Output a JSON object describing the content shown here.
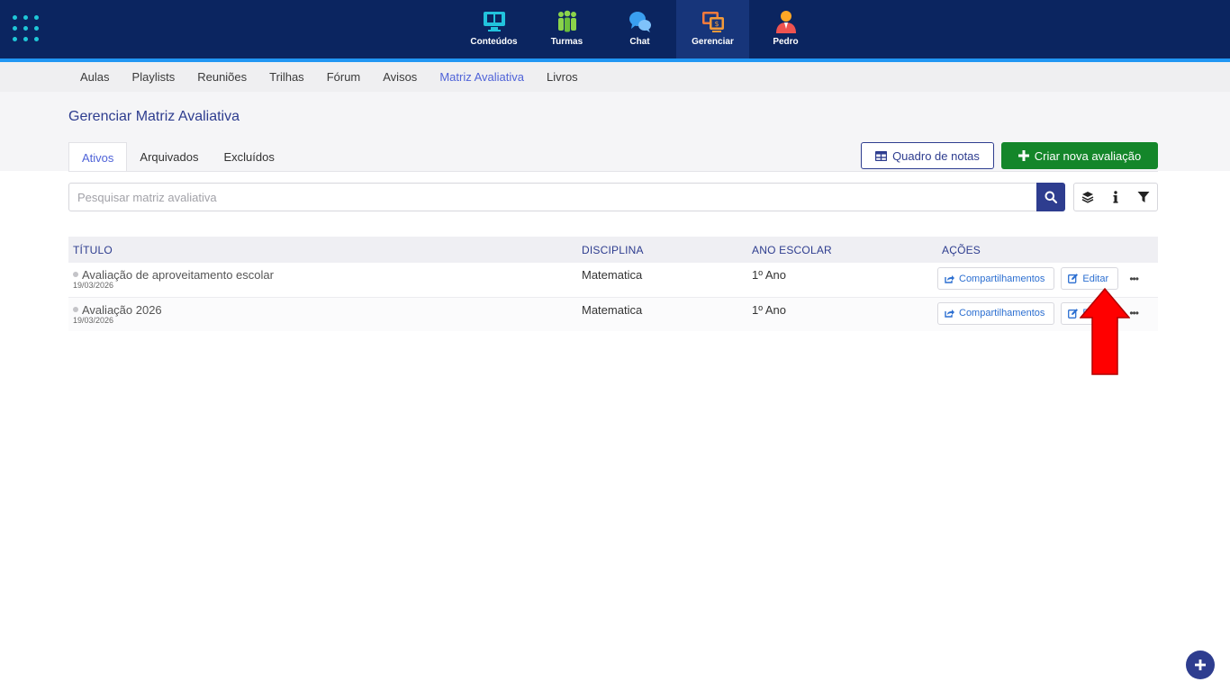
{
  "topnav": {
    "items": [
      {
        "label": "Conteúdos",
        "icon": "monitor-book-icon"
      },
      {
        "label": "Turmas",
        "icon": "people-group-icon"
      },
      {
        "label": "Chat",
        "icon": "chat-bubbles-icon"
      },
      {
        "label": "Gerenciar",
        "icon": "manage-screens-icon",
        "active": true
      },
      {
        "label": "Pedro",
        "icon": "user-avatar-icon"
      }
    ]
  },
  "subnav": {
    "items": [
      "Aulas",
      "Playlists",
      "Reuniões",
      "Trilhas",
      "Fórum",
      "Avisos",
      "Matriz Avaliativa",
      "Livros"
    ],
    "active": "Matriz Avaliativa"
  },
  "page": {
    "title": "Gerenciar Matriz Avaliativa",
    "tabs": [
      "Ativos",
      "Arquivados",
      "Excluídos"
    ],
    "active_tab": "Ativos",
    "gradebook_button": "Quadro de notas",
    "create_button": "Criar nova avaliação"
  },
  "search": {
    "placeholder": "Pesquisar matriz avaliativa",
    "value": ""
  },
  "table": {
    "headers": [
      "TÍTULO",
      "DISCIPLINA",
      "ANO ESCOLAR",
      "AÇÕES"
    ],
    "rows": [
      {
        "title": "Avaliação de aproveitamento escolar",
        "date": "19/03/2026",
        "discipline": "Matematica",
        "grade": "1º Ano"
      },
      {
        "title": "Avaliação 2026",
        "date": "19/03/2026",
        "discipline": "Matematica",
        "grade": "1º Ano"
      }
    ],
    "share_label": "Compartilhamentos",
    "edit_label": "Editar",
    "more_label": "•••"
  },
  "colors": {
    "topbar": "#0b2560",
    "accent": "#2e3d8f",
    "active_link": "#4f63d8",
    "green": "#14862a",
    "annotation_arrow": "#ff0000"
  }
}
